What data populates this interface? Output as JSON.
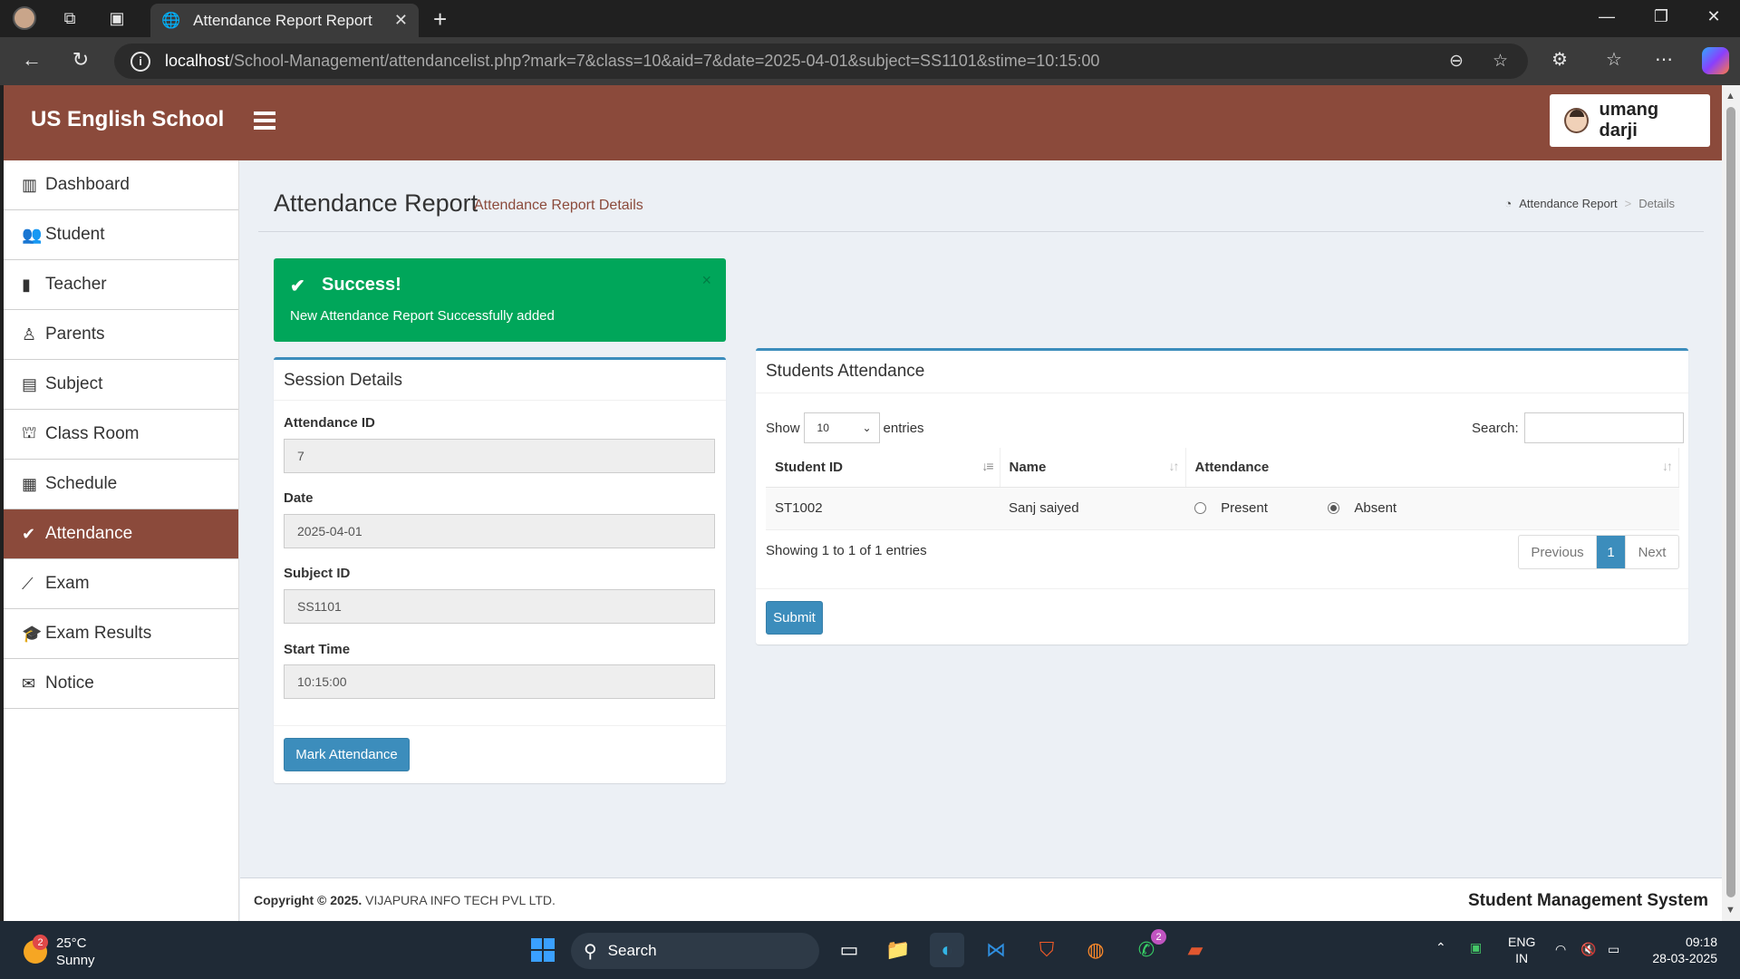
{
  "browser": {
    "tab_title": "Attendance Report Report",
    "url_host": "localhost",
    "url_path": "/School-Management/attendancelist.php?mark=7&class=10&aid=7&date=2025-04-01&subject=SS1101&stime=10:15:00"
  },
  "header": {
    "logo": "US English School",
    "user_name": "umang darji"
  },
  "sidebar": {
    "items": [
      {
        "label": "Dashboard",
        "icon": "bar-chart-icon",
        "glyph": "▥"
      },
      {
        "label": "Student",
        "icon": "users-icon",
        "glyph": "👥"
      },
      {
        "label": "Teacher",
        "icon": "teacher-icon",
        "glyph": "▮"
      },
      {
        "label": "Parents",
        "icon": "child-icon",
        "glyph": "♙"
      },
      {
        "label": "Subject",
        "icon": "book-icon",
        "glyph": "▤"
      },
      {
        "label": "Class Room",
        "icon": "bank-icon",
        "glyph": "⛫"
      },
      {
        "label": "Schedule",
        "icon": "calendar-icon",
        "glyph": "▦"
      },
      {
        "label": "Attendance",
        "icon": "check-icon",
        "glyph": "✔"
      },
      {
        "label": "Exam",
        "icon": "line-chart-icon",
        "glyph": "⟋"
      },
      {
        "label": "Exam Results",
        "icon": "graduation-cap-icon",
        "glyph": "🎓"
      },
      {
        "label": "Notice",
        "icon": "envelope-icon",
        "glyph": "✉"
      }
    ],
    "active_index": 7
  },
  "page": {
    "title": "Attendance Report",
    "subtitle": "Attendance Report Details",
    "breadcrumb": [
      "Attendance Report",
      "Details"
    ]
  },
  "alert": {
    "title": "Success!",
    "message": "New Attendance Report Successfully added",
    "close": "×"
  },
  "session": {
    "title": "Session Details",
    "fields": [
      {
        "label": "Attendance ID",
        "value": "7"
      },
      {
        "label": "Date",
        "value": "2025-04-01"
      },
      {
        "label": "Subject ID",
        "value": "SS1101"
      },
      {
        "label": "Start Time",
        "value": "10:15:00"
      }
    ],
    "button": "Mark Attendance"
  },
  "students": {
    "title": "Students Attendance",
    "show_label": "Show",
    "entries_value": "10",
    "entries_label": "entries",
    "search_label": "Search:",
    "columns": [
      "Student ID",
      "Name",
      "Attendance"
    ],
    "rows": [
      {
        "student_id": "ST1002",
        "name": "Sanj saiyed",
        "present_label": "Present",
        "absent_label": "Absent",
        "selected": "Absent"
      }
    ],
    "info": "Showing 1 to 1 of 1 entries",
    "pager": {
      "previous": "Previous",
      "page": "1",
      "next": "Next"
    },
    "submit": "Submit"
  },
  "footer": {
    "copyright_bold": "Copyright © 2025.",
    "copyright_rest": " VIJAPURA INFO TECH PVL LTD.",
    "right": "Student Management System"
  },
  "taskbar": {
    "weather_temp": "25°C",
    "weather_desc": "Sunny",
    "weather_badge": "2",
    "search": "Search",
    "whatsapp_badge": "2",
    "lang_top": "ENG",
    "lang_bottom": "IN",
    "time": "09:18",
    "date": "28-03-2025"
  },
  "colors": {
    "brand": "#8b4a3b",
    "success": "#00a65a",
    "primary": "#3c8dbc"
  }
}
